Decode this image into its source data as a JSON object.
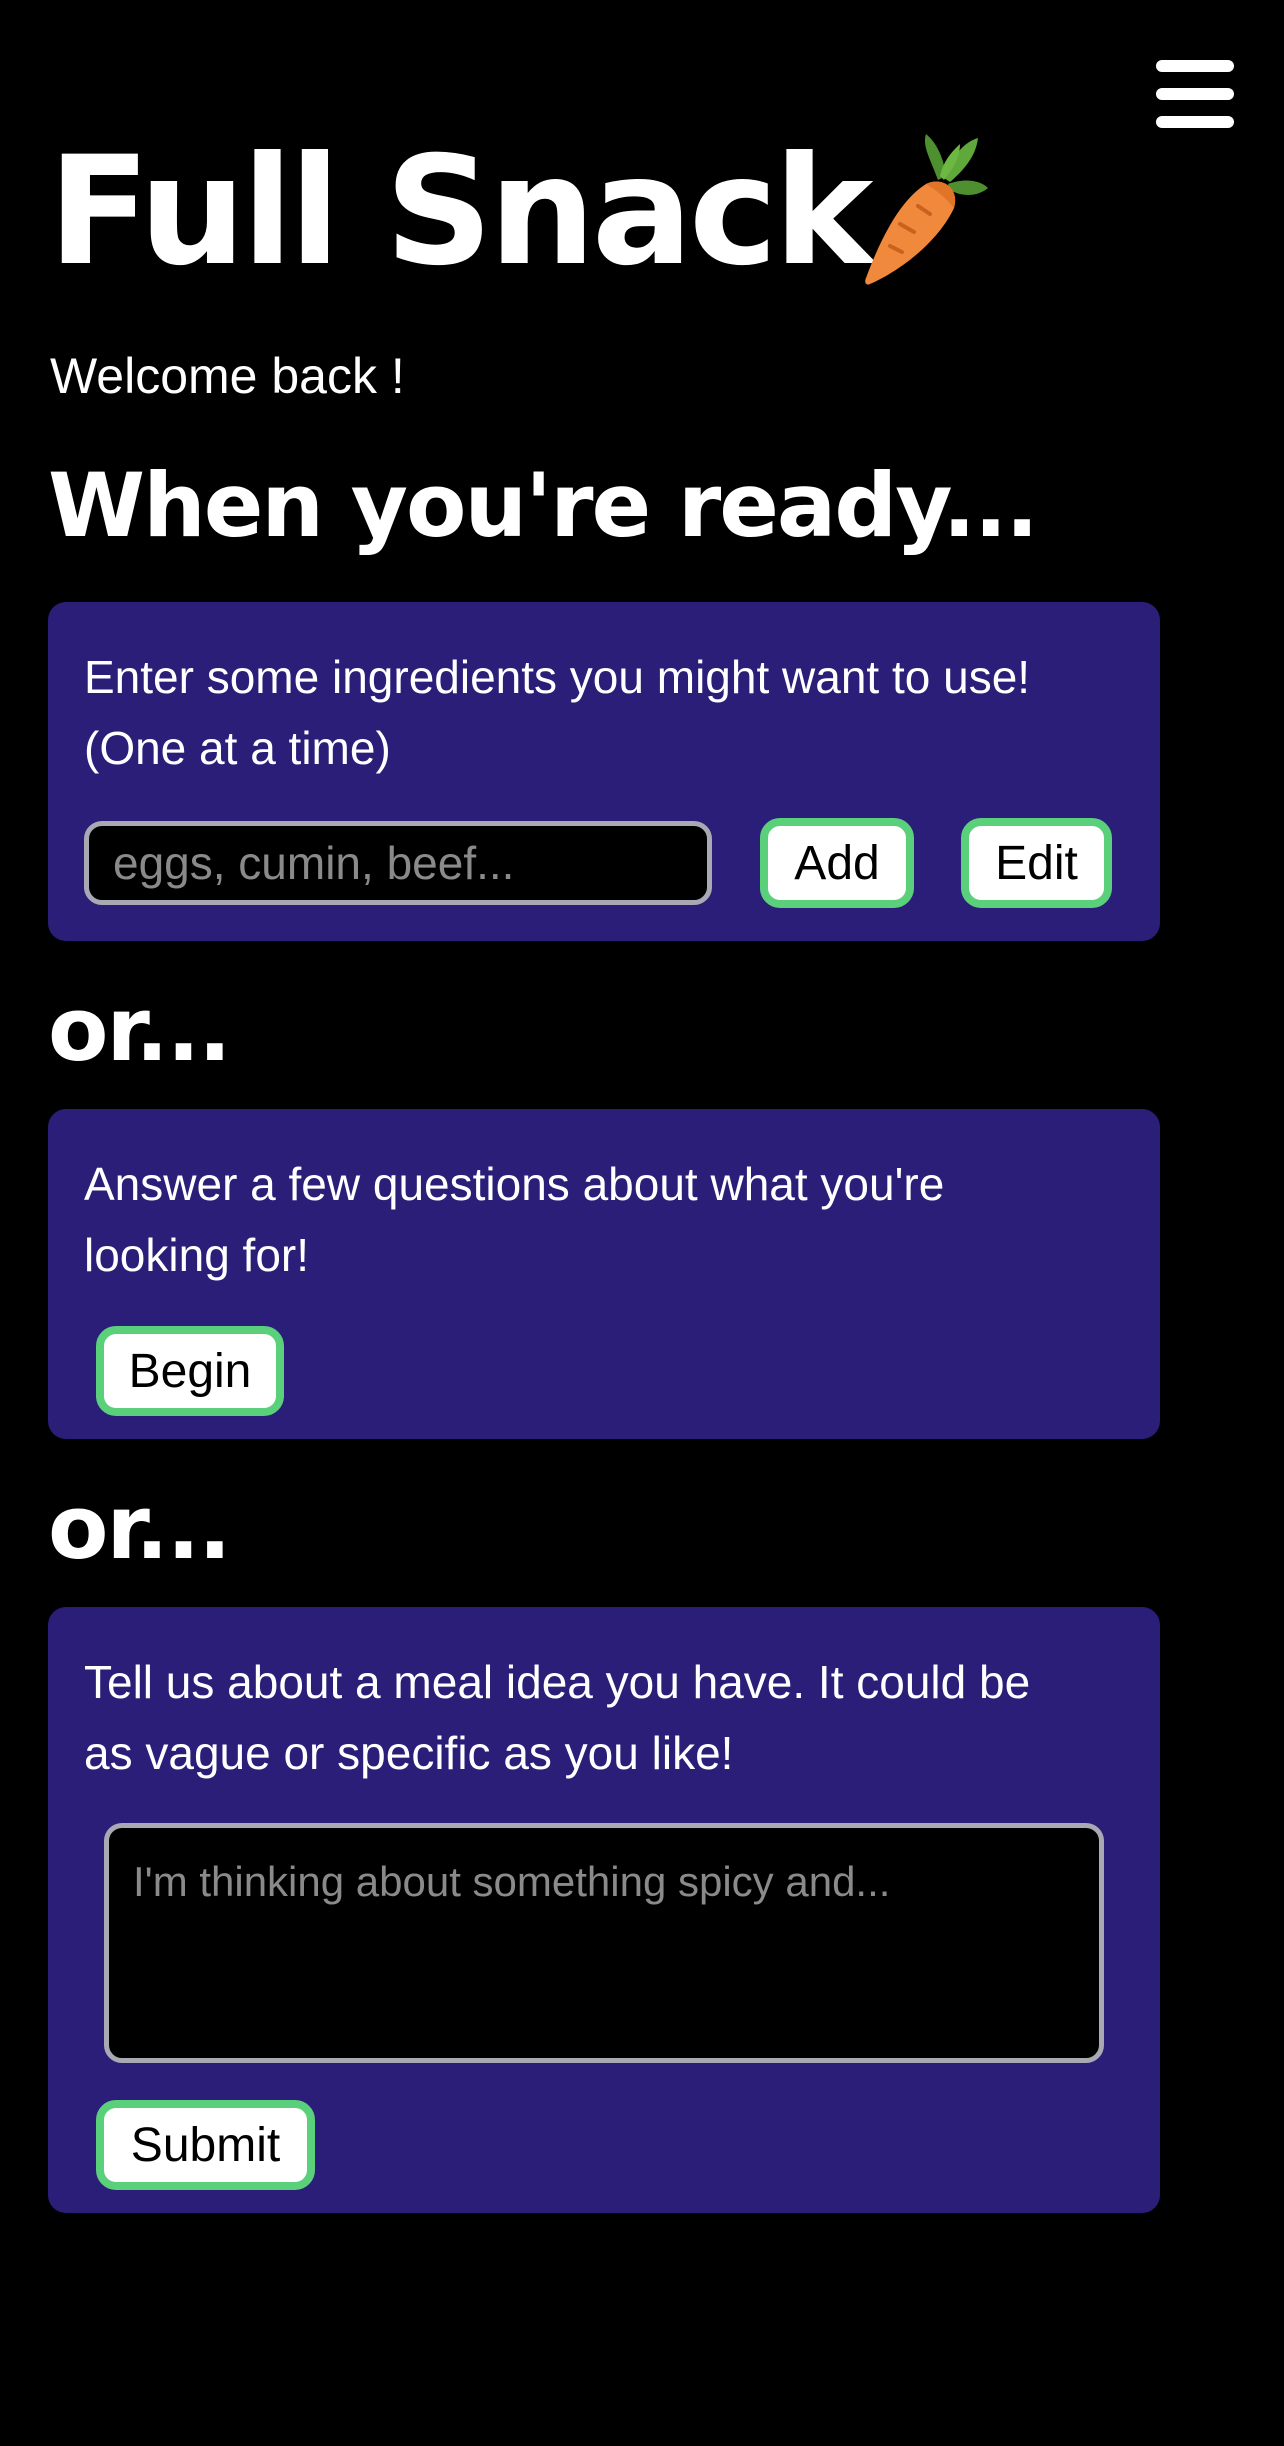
{
  "header": {
    "title": "Full Snack",
    "logo_icon": "carrot-icon",
    "menu_icon": "hamburger-menu-icon"
  },
  "welcome_text": "Welcome back !",
  "ready_heading": "When you're ready...",
  "or_heading_1": "or...",
  "or_heading_2": "or...",
  "ingredients_card": {
    "line1": "Enter some ingredients you might want to use!",
    "line2": "(One at a time)",
    "input_placeholder": "eggs, cumin, beef...",
    "add_label": "Add",
    "edit_label": "Edit"
  },
  "questions_card": {
    "line1": "Answer a few questions about what you're",
    "line2": "looking for!",
    "begin_label": "Begin"
  },
  "meal_idea_card": {
    "line1": "Tell us about a meal idea you have. It could be",
    "line2": "as vague or specific as you like!",
    "textarea_placeholder": "I'm thinking about something spicy and...",
    "submit_label": "Submit"
  },
  "colors": {
    "background": "#000000",
    "card": "#2b1e79",
    "button_border": "#5bd07a",
    "input_border": "#a9a9b4"
  }
}
